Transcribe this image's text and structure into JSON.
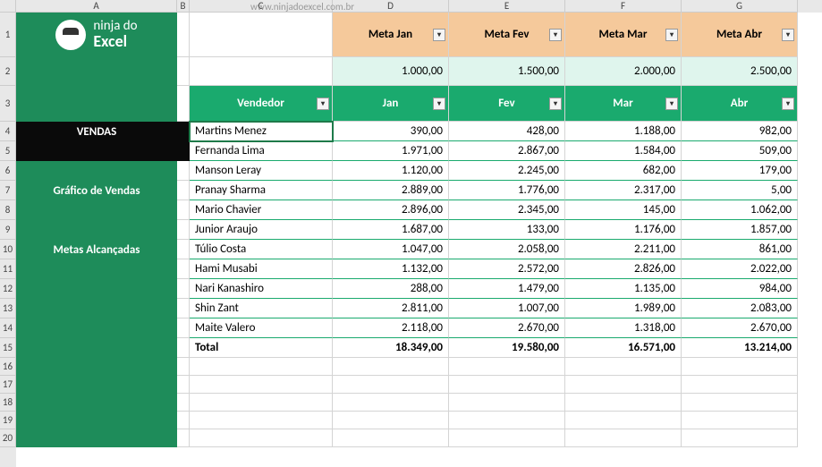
{
  "watermark": "www.ninjadoexcel.com.br",
  "columns": [
    "A",
    "B",
    "C",
    "D",
    "E",
    "F",
    "G"
  ],
  "rows": [
    "1",
    "2",
    "3",
    "4",
    "5",
    "6",
    "7",
    "8",
    "9",
    "10",
    "11",
    "12",
    "13",
    "14",
    "15",
    "16",
    "17",
    "18",
    "19",
    "20"
  ],
  "logo": {
    "line1": "ninja do",
    "line2": "Excel"
  },
  "sidebar": {
    "vendas": "VENDAS",
    "grafico": "Gráfico de Vendas",
    "metas": "Metas Alcançadas"
  },
  "meta_headers": [
    "Meta Jan",
    "Meta Fev",
    "Meta Mar",
    "Meta Abr"
  ],
  "meta_values": [
    "1.000,00",
    "1.500,00",
    "2.000,00",
    "2.500,00"
  ],
  "table_headers": [
    "Vendedor",
    "Jan",
    "Fev",
    "Mar",
    "Abr"
  ],
  "data": [
    {
      "vendedor": "Martins Menez",
      "jan": "390,00",
      "fev": "428,00",
      "mar": "1.188,00",
      "abr": "982,00"
    },
    {
      "vendedor": "Fernanda Lima",
      "jan": "1.971,00",
      "fev": "2.867,00",
      "mar": "1.584,00",
      "abr": "509,00"
    },
    {
      "vendedor": "Manson Leray",
      "jan": "1.120,00",
      "fev": "2.245,00",
      "mar": "682,00",
      "abr": "179,00"
    },
    {
      "vendedor": "Pranay Sharma",
      "jan": "2.889,00",
      "fev": "1.776,00",
      "mar": "2.317,00",
      "abr": "5,00"
    },
    {
      "vendedor": "Mario Chavier",
      "jan": "2.896,00",
      "fev": "2.345,00",
      "mar": "145,00",
      "abr": "1.062,00"
    },
    {
      "vendedor": "Junior Araujo",
      "jan": "1.687,00",
      "fev": "133,00",
      "mar": "1.176,00",
      "abr": "1.857,00"
    },
    {
      "vendedor": "Túlio Costa",
      "jan": "1.047,00",
      "fev": "2.058,00",
      "mar": "2.211,00",
      "abr": "861,00"
    },
    {
      "vendedor": "Hami Musabi",
      "jan": "1.132,00",
      "fev": "2.572,00",
      "mar": "2.826,00",
      "abr": "2.022,00"
    },
    {
      "vendedor": "Nari Kanashiro",
      "jan": "288,00",
      "fev": "1.479,00",
      "mar": "1.135,00",
      "abr": "984,00"
    },
    {
      "vendedor": "Shin Zant",
      "jan": "2.811,00",
      "fev": "1.007,00",
      "mar": "1.989,00",
      "abr": "2.083,00"
    },
    {
      "vendedor": "Maite Valero",
      "jan": "2.118,00",
      "fev": "2.670,00",
      "mar": "1.318,00",
      "abr": "2.670,00"
    }
  ],
  "totals": {
    "label": "Total",
    "jan": "18.349,00",
    "fev": "19.580,00",
    "mar": "16.571,00",
    "abr": "13.214,00"
  }
}
